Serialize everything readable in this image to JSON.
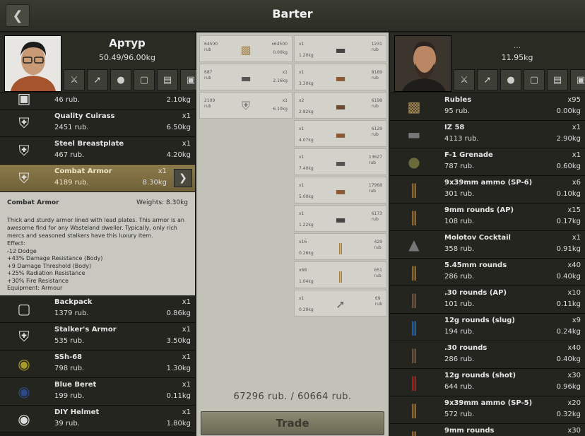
{
  "header": {
    "title": "Barter",
    "back_icon": "chevron-left-icon"
  },
  "player": {
    "name": "Артур",
    "weight": "50.49/96.00kg",
    "filters": [
      "weapons-icon",
      "knife-icon",
      "grenade-icon",
      "backpack-icon",
      "book-icon",
      "box-icon"
    ]
  },
  "player_items_top": {
    "price": "46 rub.",
    "weight": "2.10kg"
  },
  "player_items": [
    {
      "name": "Quality Cuirass",
      "price": "2451 rub.",
      "qty": "x1",
      "weight": "6.50kg"
    },
    {
      "name": "Steel Breastplate",
      "price": "467 rub.",
      "qty": "x1",
      "weight": "4.20kg"
    },
    {
      "name": "Combat Armor",
      "price": "4189 rub.",
      "qty": "x1",
      "weight": "8.30kg"
    }
  ],
  "description": {
    "title": "Combat Armor",
    "weights": "Weights: 8.30kg",
    "text": "Thick and sturdy armor lined with lead plates. This armor is an awesome find for any Wasteland dweller. Typically, only rich mercs and seasoned stalkers have this luxury item.",
    "effect_label": "Effect:",
    "effects": [
      "-12 Dodge",
      "+43% Damage Resistance (Body)",
      "+9 Damage Threshold (Body)",
      "+25% Radiation Resistance",
      "+30% Fire Resistance"
    ],
    "equipment": "Equipment: Armour"
  },
  "player_items_bottom": [
    {
      "name": "Backpack",
      "price": "1379 rub.",
      "qty": "x1",
      "weight": "0.86kg"
    },
    {
      "name": "Stalker's Armor",
      "price": "535 rub.",
      "qty": "x1",
      "weight": "3.50kg"
    },
    {
      "name": "SSh-68",
      "price": "798 rub.",
      "qty": "x1",
      "weight": "1.30kg"
    },
    {
      "name": "Blue Beret",
      "price": "199 rub.",
      "qty": "x1",
      "weight": "0.11kg"
    },
    {
      "name": "DIY Helmet",
      "price": "39 rub.",
      "qty": "x1",
      "weight": "1.80kg"
    }
  ],
  "trader": {
    "name": "...",
    "weight": "11.95kg"
  },
  "trader_items": [
    {
      "name": "Rubles",
      "price": "95 rub.",
      "qty": "x95",
      "weight": "0.00kg"
    },
    {
      "name": "IZ 58",
      "price": "4113 rub.",
      "qty": "x1",
      "weight": "2.90kg"
    },
    {
      "name": "F-1 Grenade",
      "price": "787 rub.",
      "qty": "x1",
      "weight": "0.60kg"
    },
    {
      "name": "9x39mm ammo (SP-6)",
      "price": "301 rub.",
      "qty": "x6",
      "weight": "0.10kg"
    },
    {
      "name": "9mm rounds (AP)",
      "price": "108 rub.",
      "qty": "x15",
      "weight": "0.17kg"
    },
    {
      "name": "Molotov Cocktail",
      "price": "358 rub.",
      "qty": "x1",
      "weight": "0.91kg"
    },
    {
      "name": "5.45mm rounds",
      "price": "286 rub.",
      "qty": "x40",
      "weight": "0.40kg"
    },
    {
      "name": ".30 rounds (AP)",
      "price": "101 rub.",
      "qty": "x10",
      "weight": "0.11kg"
    },
    {
      "name": "12g rounds (slug)",
      "price": "194 rub.",
      "qty": "x9",
      "weight": "0.24kg"
    },
    {
      "name": ".30 rounds",
      "price": "286 rub.",
      "qty": "x40",
      "weight": "0.40kg"
    },
    {
      "name": "12g rounds (shot)",
      "price": "644 rub.",
      "qty": "x30",
      "weight": "0.96kg"
    },
    {
      "name": "9x39mm ammo (SP-5)",
      "price": "572 rub.",
      "qty": "x20",
      "weight": "0.32kg"
    },
    {
      "name": "9mm rounds",
      "price": "",
      "qty": "x30",
      "weight": ""
    }
  ],
  "offer_left": [
    {
      "val": "64500",
      "unit": "rub",
      "qty": "x64500",
      "weight": "0.00kg"
    },
    {
      "val": "687",
      "unit": "rub",
      "qty": "x1",
      "weight": "2.16kg"
    },
    {
      "val": "2109",
      "unit": "rub",
      "qty": "x1",
      "weight": "6.10kg"
    }
  ],
  "offer_right": [
    {
      "val": "1231",
      "unit": "rub",
      "qty": "x1",
      "weight": "1.20kg"
    },
    {
      "val": "8189",
      "unit": "rub",
      "qty": "x1",
      "weight": "3.30kg"
    },
    {
      "val": "6198",
      "unit": "rub",
      "qty": "x2",
      "weight": "2.82kg"
    },
    {
      "val": "6129",
      "unit": "rub",
      "qty": "x1",
      "weight": "4.07kg"
    },
    {
      "val": "13627",
      "unit": "rub",
      "qty": "x1",
      "weight": "7.40kg"
    },
    {
      "val": "17968",
      "unit": "rub",
      "qty": "x1",
      "weight": "5.00kg"
    },
    {
      "val": "6173",
      "unit": "rub",
      "qty": "x1",
      "weight": "1.22kg"
    },
    {
      "val": "429",
      "unit": "rub",
      "qty": "x16",
      "weight": "0.26kg"
    },
    {
      "val": "651",
      "unit": "rub",
      "qty": "x68",
      "weight": "1.04kg"
    },
    {
      "val": "69",
      "unit": "rub",
      "qty": "x1",
      "weight": "0.29kg"
    }
  ],
  "totals": {
    "left": "67296",
    "right": "60664",
    "unit": "rub."
  },
  "trade_label": "Trade"
}
